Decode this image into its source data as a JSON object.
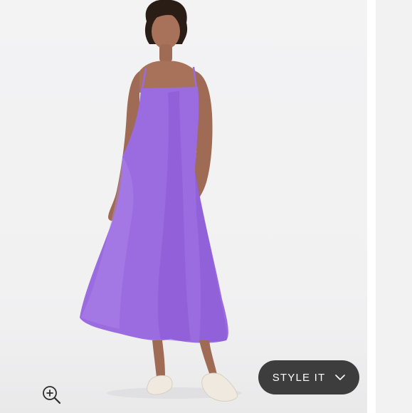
{
  "listing": {
    "image_alt_subject": "woman-in-purple-midi-slip-dress",
    "accent_color": "#9b6be0",
    "button_bg": "#3d3d3d"
  },
  "actions": {
    "style_it_label": "STYLE IT",
    "style_it_icon": "chevron-down-icon",
    "zoom_icon": "zoom-in-icon"
  }
}
